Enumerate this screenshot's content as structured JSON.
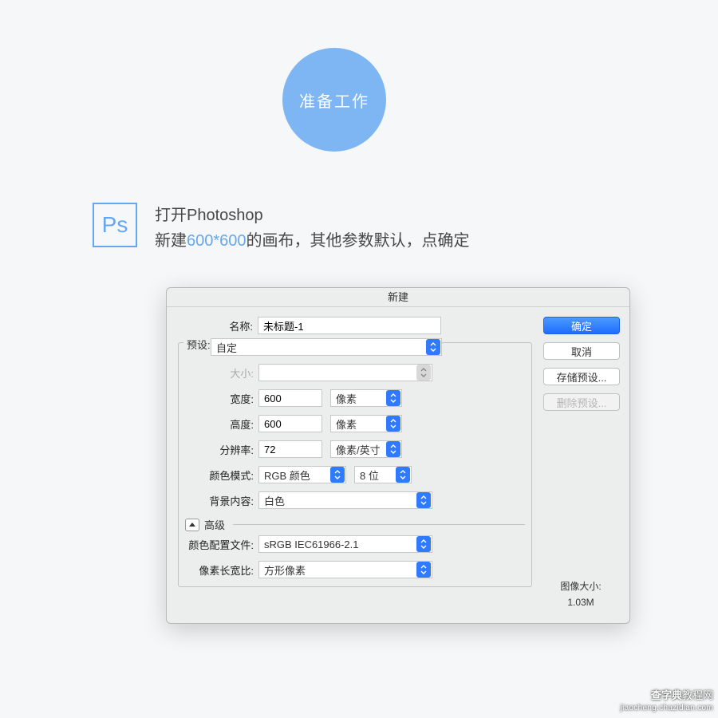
{
  "badge": {
    "label": "准备工作"
  },
  "ps": {
    "glyph": "Ps"
  },
  "instruction": {
    "line1": "打开Photoshop",
    "line2_a": "新建",
    "line2_hl": "600*600",
    "line2_b": "的画布，其他参数默认，点确定"
  },
  "dialog": {
    "title": "新建",
    "name": {
      "label": "名称:",
      "value": "未标题-1"
    },
    "preset": {
      "label": "预设:",
      "value": "自定"
    },
    "size": {
      "label": "大小:",
      "value": ""
    },
    "width": {
      "label": "宽度:",
      "value": "600",
      "unit": "像素"
    },
    "height": {
      "label": "高度:",
      "value": "600",
      "unit": "像素"
    },
    "resolution": {
      "label": "分辨率:",
      "value": "72",
      "unit": "像素/英寸"
    },
    "color_mode": {
      "label": "颜色模式:",
      "value": "RGB 颜色",
      "depth": "8 位"
    },
    "bg": {
      "label": "背景内容:",
      "value": "白色"
    },
    "advanced": {
      "label": "高级"
    },
    "profile": {
      "label": "颜色配置文件:",
      "value": "sRGB IEC61966-2.1"
    },
    "aspect": {
      "label": "像素长宽比:",
      "value": "方形像素"
    },
    "image_size": {
      "label": "图像大小:",
      "value": "1.03M"
    },
    "buttons": {
      "ok": "确定",
      "cancel": "取消",
      "save_preset": "存储预设...",
      "delete_preset": "删除预设..."
    }
  },
  "watermark": {
    "site_a": "查字典",
    "site_b": "教程网",
    "url": "jiaocheng.chazidian.com"
  }
}
